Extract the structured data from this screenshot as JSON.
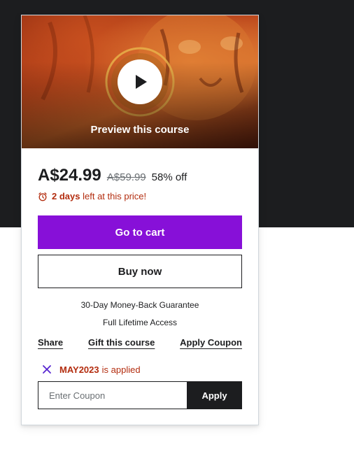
{
  "preview": {
    "label": "Preview this course"
  },
  "pricing": {
    "current_price": "A$24.99",
    "original_price": "A$59.99",
    "discount": "58% off",
    "timer_days": "2 days",
    "timer_text": "left at this price!"
  },
  "actions": {
    "go_to_cart": "Go to cart",
    "buy_now": "Buy now"
  },
  "info": {
    "guarantee": "30-Day Money-Back Guarantee",
    "access": "Full Lifetime Access"
  },
  "links": {
    "share": "Share",
    "gift": "Gift this course",
    "apply_coupon": "Apply Coupon"
  },
  "coupon": {
    "applied_code": "MAY2023",
    "applied_text": "is applied",
    "input_placeholder": "Enter Coupon",
    "apply_label": "Apply"
  },
  "colors": {
    "accent": "#8710d8",
    "dark": "#1c1d1f",
    "alert": "#b32d0f"
  },
  "icons": {
    "play": "play-icon",
    "timer": "alarm-clock-icon",
    "remove": "close-icon"
  }
}
